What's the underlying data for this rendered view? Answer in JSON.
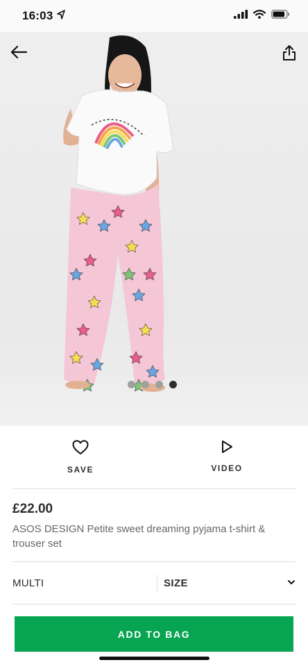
{
  "status_bar": {
    "time": "16:03",
    "location_icon": "location-arrow-icon",
    "signal_icon": "cellular-signal-icon",
    "wifi_icon": "wifi-icon",
    "battery_icon": "battery-icon"
  },
  "nav": {
    "back_icon": "arrow-left-icon",
    "share_icon": "share-icon"
  },
  "gallery": {
    "image_count": 4,
    "active_index": 3
  },
  "actions": {
    "save_label": "SAVE",
    "save_icon": "heart-icon",
    "video_label": "VIDEO",
    "video_icon": "play-icon"
  },
  "product": {
    "price": "£22.00",
    "name": "ASOS DESIGN Petite sweet dreaming pyjama t-shirt & trouser set"
  },
  "selectors": {
    "colour": "MULTI",
    "size_label": "SIZE",
    "size_icon": "chevron-down-icon"
  },
  "cta": {
    "label": "ADD TO BAG"
  },
  "colors": {
    "accent": "#07a452",
    "text": "#2d2d2d",
    "muted": "#666666",
    "trouser": "#f4c6d6"
  }
}
